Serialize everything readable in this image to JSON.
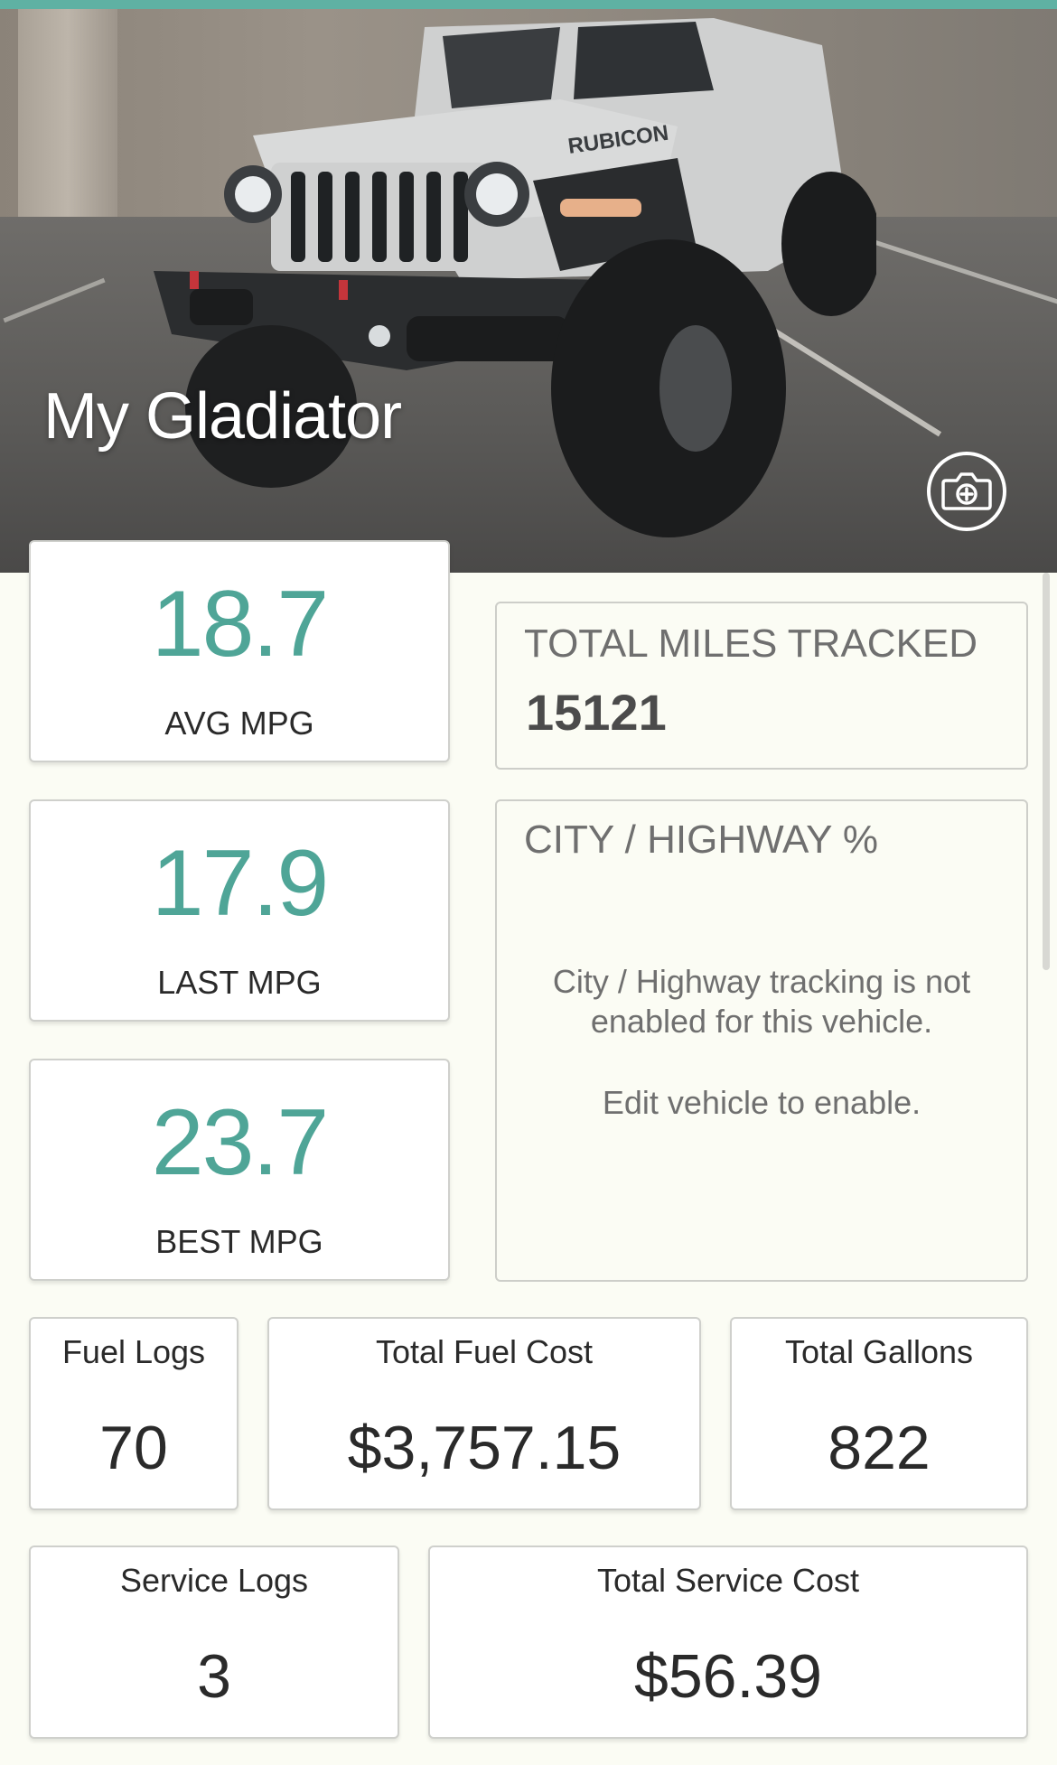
{
  "vehicle": {
    "name": "My Gladiator",
    "photo_alt": "white jeep gladiator in parking lot"
  },
  "header": {
    "camera_icon": "camera-plus-icon"
  },
  "mpg": {
    "avg": {
      "value": "18.7",
      "label": "AVG MPG"
    },
    "last": {
      "value": "17.9",
      "label": "LAST MPG"
    },
    "best": {
      "value": "23.7",
      "label": "BEST MPG"
    }
  },
  "miles": {
    "title": "TOTAL MILES TRACKED",
    "value": "15121"
  },
  "city_highway": {
    "title": "CITY / HIGHWAY %",
    "message": "City / Highway tracking is not enabled for this vehicle.",
    "hint": "Edit vehicle to enable."
  },
  "fuel": {
    "logs": {
      "label": "Fuel Logs",
      "value": "70"
    },
    "cost": {
      "label": "Total Fuel Cost",
      "value": "$3,757.15"
    },
    "gallons": {
      "label": "Total Gallons",
      "value": "822"
    }
  },
  "service": {
    "logs": {
      "label": "Service Logs",
      "value": "3"
    },
    "cost": {
      "label": "Total Service Cost",
      "value": "$56.39"
    }
  },
  "colors": {
    "accent": "#4fa597",
    "top_strip": "#5fb1a3",
    "background": "#fbfcf4"
  }
}
